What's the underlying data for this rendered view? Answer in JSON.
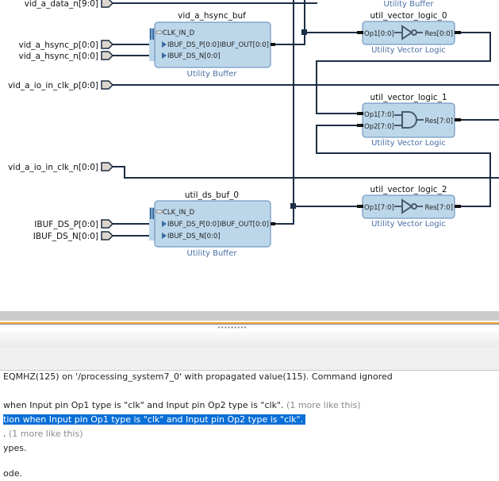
{
  "diagram": {
    "ports": [
      {
        "label": "vid_a_data_n[9:0]"
      },
      {
        "label": "vid_a_hsync_p[0:0]"
      },
      {
        "label": "vid_a_hsync_n[0:0]"
      },
      {
        "label": "vid_a_io_in_clk_p[0:0]"
      },
      {
        "label": "vid_a_io_in_clk_n[0:0]"
      },
      {
        "label": "IBUF_DS_P[0:0]"
      },
      {
        "label": "IBUF_DS_N[0:0]"
      }
    ],
    "top_partial_subtitle": "Utility Buffer",
    "blocks": {
      "hsync_buf": {
        "name": "vid_a_hsync_buf",
        "type": "Utility Buffer",
        "pin_clk": "CLK_IN_D",
        "pin_p": "IBUF_DS_P[0:0]",
        "pin_n": "IBUF_DS_N[0:0]",
        "pin_out": "IBUF_OUT[0:0]"
      },
      "ds_buf": {
        "name": "util_ds_buf_0",
        "type": "Utility Buffer",
        "pin_clk": "CLK_IN_D",
        "pin_p": "IBUF_DS_P[0:0]",
        "pin_n": "IBUF_DS_N[0:0]",
        "pin_out": "IBUF_OUT[0:0]"
      },
      "vl0": {
        "name": "util_vector_logic_0",
        "type": "Utility Vector Logic",
        "op1": "Op1[0:0]",
        "res": "Res[0:0]",
        "gate": "not"
      },
      "vl1": {
        "name": "util_vector_logic_1",
        "type": "Utility Vector Logic",
        "op1": "Op1[7:0]",
        "op2": "Op2[7:0]",
        "res": "Res[7:0]",
        "gate": "and"
      },
      "vl2": {
        "name": "util_vector_logic_2",
        "type": "Utility Vector Logic",
        "op1": "Op1[7:0]",
        "res": "Res[7:0]",
        "gate": "not"
      }
    },
    "colors": {
      "block_fill": "#bdd7ea",
      "block_stroke": "#5b87b5",
      "wire": "#1c2e44",
      "port_fill": "#ddd4cc"
    }
  },
  "messages": {
    "lines": [
      {
        "text": "EQMHZ(125) on '/processing_system7_0' with propagated value(115). Command ignored",
        "more": ""
      },
      {
        "text": " when Input pin Op1 type is \"clk\" and Input pin Op2 type is \"clk\".",
        "more": "(1 more like this)"
      },
      {
        "text": "tion when Input pin Op1 type is \"clk\" and Input pin Op2 type is \"clk\".",
        "more": "",
        "selected": true
      },
      {
        "text": ".",
        "more": "(1 more like this)"
      },
      {
        "text": "ypes.",
        "more": ""
      },
      {
        "text": "ode.",
        "more": ""
      }
    ],
    "selection_color": "#0a6fd6"
  }
}
